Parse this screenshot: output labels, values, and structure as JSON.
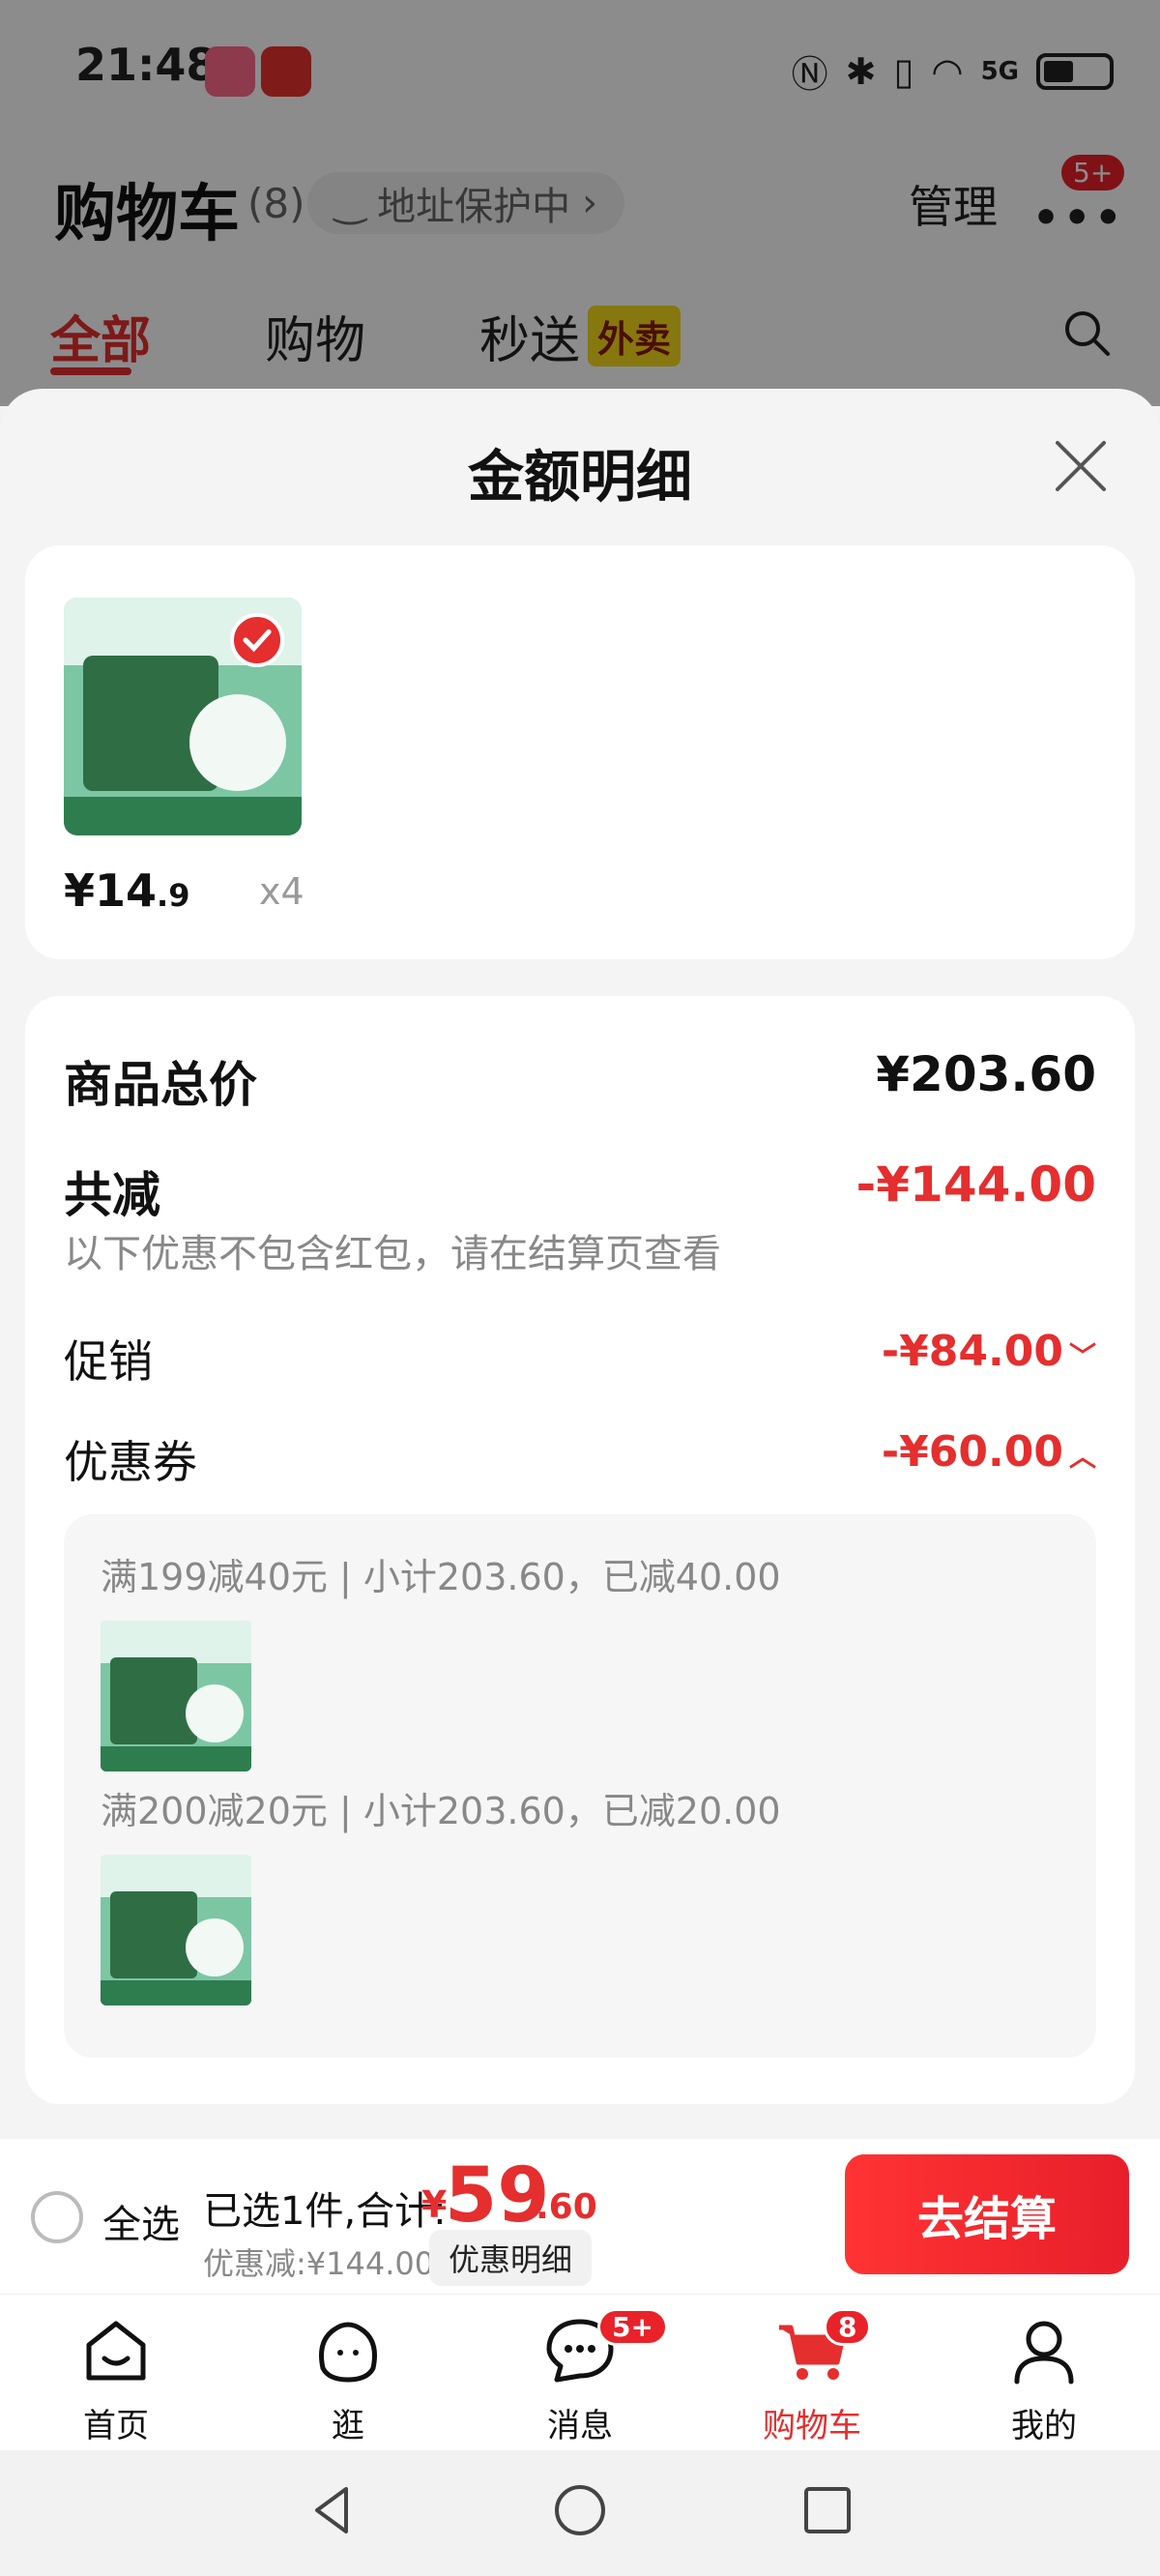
{
  "status": {
    "time": "21:48",
    "network": "5G"
  },
  "header": {
    "title": "购物车",
    "count": "(8)",
    "address_pill": "地址保护中",
    "manage": "管理",
    "more_badge": "5+"
  },
  "top_tabs": [
    {
      "label": "全部"
    },
    {
      "label": "购物"
    },
    {
      "label": "秒送"
    }
  ],
  "top_tab_tag": "外卖",
  "sheet": {
    "title": "金额明细",
    "product": {
      "price_int": "¥14",
      "price_dec": ".9",
      "qty": "x4"
    },
    "summary": {
      "total_label": "商品总价",
      "total_value": "¥203.60",
      "reduce_label": "共减",
      "reduce_value": "-¥144.00",
      "note": "以下优惠不包含红包，请在结算页查看",
      "promo_label": "促销",
      "promo_value": "-¥84.00",
      "coupon_label": "优惠券",
      "coupon_value": "-¥60.00"
    },
    "coupons": [
      {
        "text": "满199减40元 | 小计203.60，已减40.00"
      },
      {
        "text": "满200减20元 | 小计203.60，已减20.00"
      }
    ]
  },
  "checkout": {
    "select_all": "全选",
    "selected_text": "已选1件,合计:",
    "currency": "¥",
    "total_int": "59",
    "total_dec": ".60",
    "discount_text": "优惠减:¥144.00",
    "detail_button": "优惠明细",
    "pay_button": "去结算"
  },
  "tabbar": [
    {
      "label": "首页",
      "icon": "home-icon"
    },
    {
      "label": "逛",
      "icon": "explore-icon"
    },
    {
      "label": "消息",
      "icon": "message-icon",
      "badge": "5+"
    },
    {
      "label": "购物车",
      "icon": "cart-icon",
      "badge": "8"
    },
    {
      "label": "我的",
      "icon": "profile-icon"
    }
  ],
  "colors": {
    "accent": "#e52e2e",
    "sheet_bg": "#f4f4f4"
  }
}
